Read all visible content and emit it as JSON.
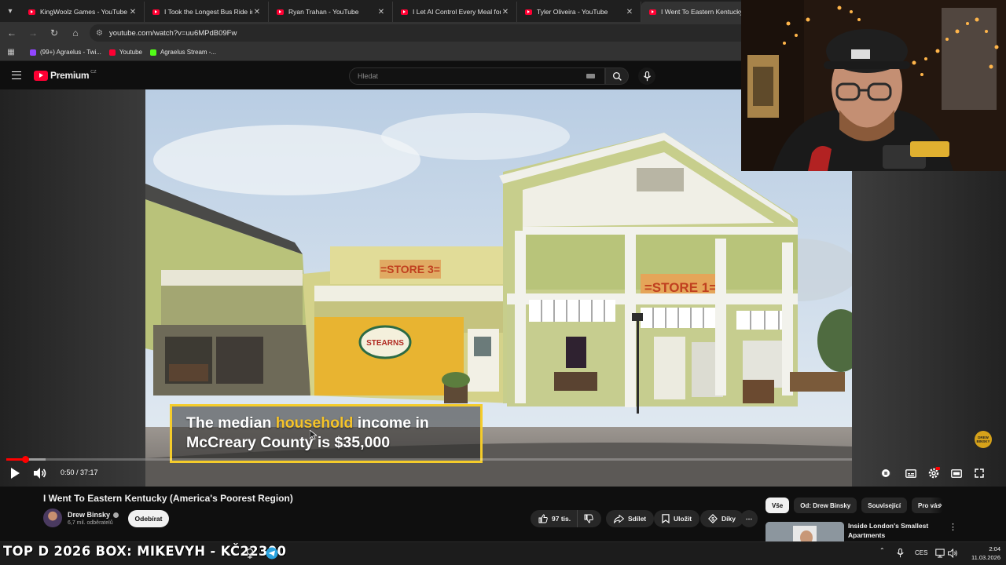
{
  "browser": {
    "tabs": [
      {
        "title": "KingWoolz Games - YouTube"
      },
      {
        "title": "I Took the Longest Bus Ride in"
      },
      {
        "title": "Ryan Trahan - YouTube"
      },
      {
        "title": "I Let AI Control Every Meal for"
      },
      {
        "title": "Tyler Oliveira - YouTube"
      },
      {
        "title": "I Went To Eastern Kentucky (A"
      }
    ],
    "url": "youtube.com/watch?v=uu6MPdB09Fw",
    "bookmarks": [
      {
        "label": "(99+) Agraelus - Twi...",
        "color": "#9146ff"
      },
      {
        "label": "Youtube",
        "color": "#ff0033"
      },
      {
        "label": "Agraelus Stream -...",
        "color": "#53fc18"
      }
    ]
  },
  "youtube": {
    "logo_text": "Premium",
    "region": "CZ",
    "search_placeholder": "Hledat"
  },
  "player": {
    "caption_pre": "The median ",
    "caption_highlight": "household",
    "caption_post": " income in McCreary County is $35,000",
    "sign_store3": "=STORE 3=",
    "sign_store1": "=STORE 1=",
    "sign_stearns": "STEARNS",
    "time": "0:50 / 37:17",
    "progress_fraction": 0.0224,
    "badge": "DREW BINSKY"
  },
  "video": {
    "title": "I Went To Eastern Kentucky (America's Poorest Region)",
    "channel": "Drew Binsky",
    "subscribers": "6,7 mil. odběratelů",
    "subscribe_label": "Odebírat",
    "likes": "97 tis.",
    "share_label": "Sdílet",
    "save_label": "Uložit",
    "thanks_label": "Díky"
  },
  "sidebar": {
    "chips": [
      "Vše",
      "Od: Drew Binsky",
      "Související",
      "Pro vás"
    ],
    "rec_title": "Inside London's Smallest Apartments"
  },
  "taskbar": {
    "ticker": "TOP D 2026 BOX: MIKEVYH - KČ22300",
    "lang": "CES",
    "time": "2:04",
    "date": "11.03.2026"
  },
  "colors": {
    "accent_red": "#ff0033",
    "caption_border": "#f5cc2a",
    "caption_highlight": "#f5c329"
  }
}
